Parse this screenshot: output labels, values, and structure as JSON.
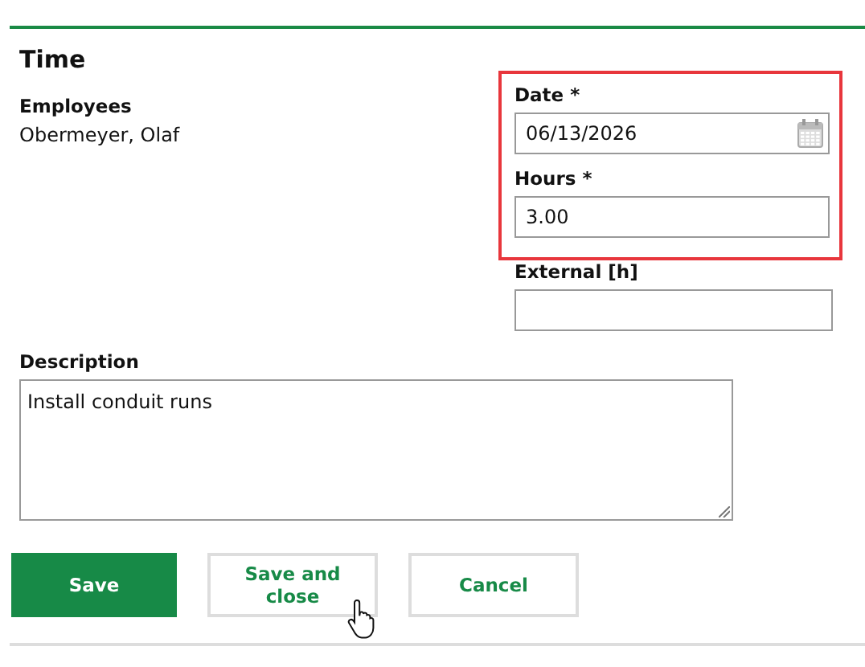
{
  "section_title": "Time",
  "employees": {
    "label": "Employees",
    "value": "Obermeyer, Olaf"
  },
  "fields": [
    {
      "label": "Date *",
      "value": "06/13/2026",
      "kind": "date",
      "highlighted": true
    },
    {
      "label": "Hours *",
      "value": "3.00",
      "kind": "text",
      "highlighted": true
    },
    {
      "label": "External [h]",
      "kind": "text",
      "highlighted": false
    }
  ],
  "description": {
    "label": "Description",
    "value": "Install conduit runs"
  },
  "buttons": [
    {
      "label": "Save",
      "kind": "primary"
    },
    {
      "label": "Save and close",
      "kind": "secondary",
      "hovered": true
    },
    {
      "label": "Cancel",
      "kind": "secondary",
      "hovered": false
    }
  ]
}
